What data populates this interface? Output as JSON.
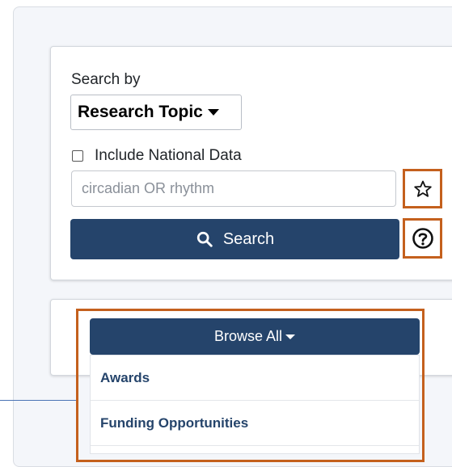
{
  "search": {
    "search_by_label": "Search by",
    "topic_select_value": "Research Topic",
    "include_national_label": "Include National Data",
    "include_national_checked": false,
    "query_placeholder": "circadian OR rhythm",
    "search_button_label": "Search"
  },
  "browse": {
    "button_label": "Browse All",
    "menu_items": [
      {
        "label": "Awards"
      },
      {
        "label": "Funding Opportunities"
      }
    ]
  },
  "icons": {
    "star": "star-outline-icon",
    "help": "question-circle-icon",
    "search": "magnifier-icon",
    "caret": "caret-down-icon"
  },
  "colors": {
    "primary": "#25446b",
    "highlight": "#c4601d",
    "link": "#25446b",
    "pointer_line": "#4a73b5"
  }
}
